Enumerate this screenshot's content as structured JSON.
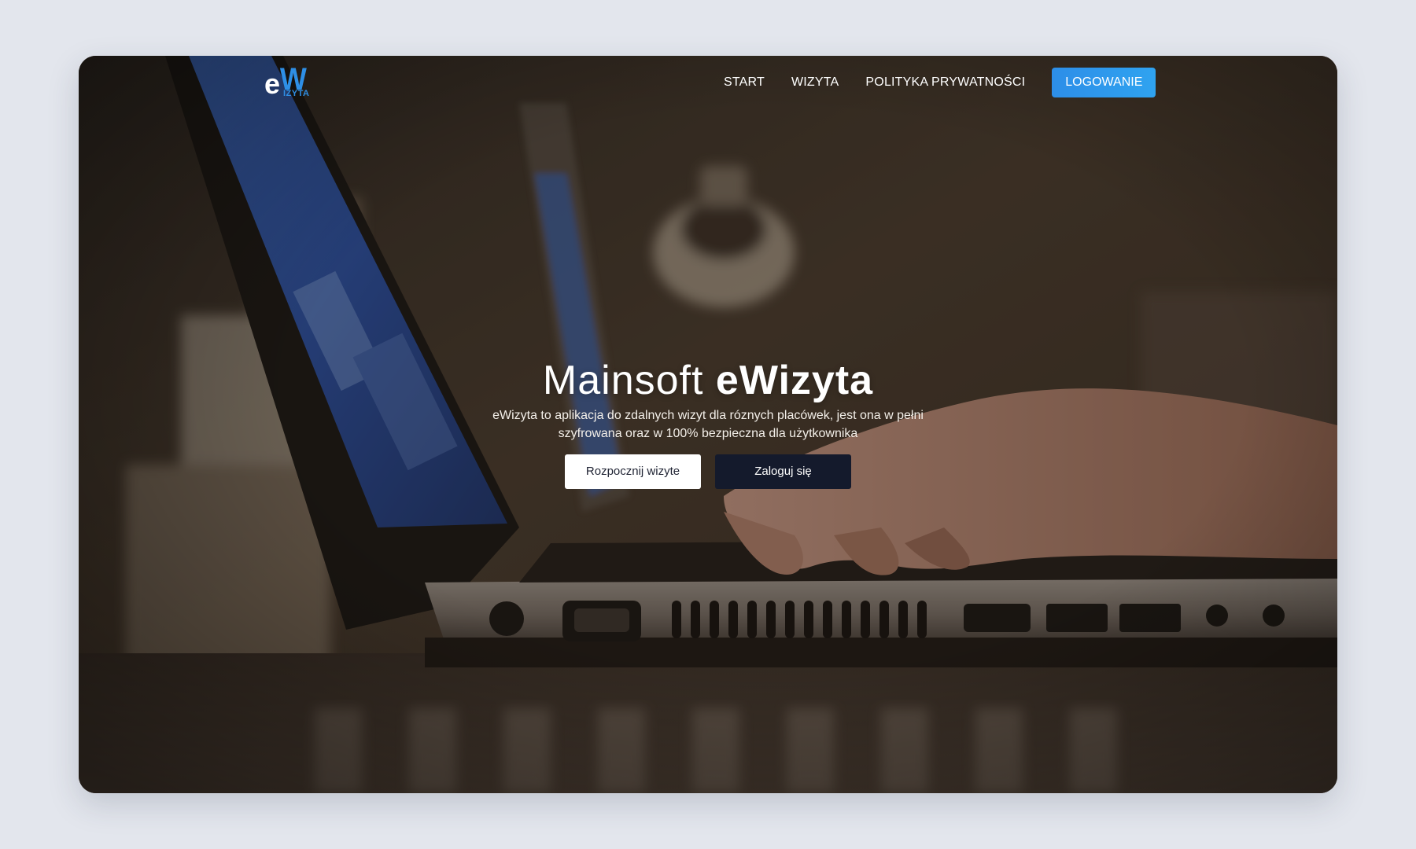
{
  "brand": {
    "logo_e": "e",
    "logo_w": "W",
    "logo_sub": "IZYTA",
    "accent": "#2e8fe6"
  },
  "nav": {
    "items": [
      {
        "label": "START"
      },
      {
        "label": "WIZYTA"
      },
      {
        "label": "POLITYKA PRYWATNOŚCI"
      }
    ],
    "login_label": "LOGOWANIE"
  },
  "hero": {
    "title_light": "Mainsoft ",
    "title_bold": "eWizyta",
    "description": "eWizyta to aplikacja do zdalnych wizyt dla róznych placówek, jest ona w pełni szyfrowana oraz w 100% bezpieczna dla użytkownika",
    "start_button": "Rozpocznij wizyte",
    "login_button": "Zaloguj się"
  },
  "colors": {
    "page_bg": "#e3e6ed",
    "login_button": "#2e8fe6",
    "dark_button": "#141a2c"
  }
}
